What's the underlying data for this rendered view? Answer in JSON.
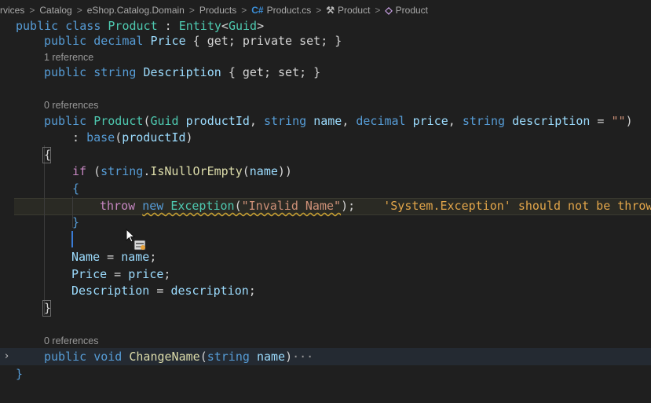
{
  "breadcrumb": {
    "items": [
      "rvices",
      "Catalog",
      "eShop.Catalog.Domain",
      "Products",
      "Product.cs",
      "Product",
      "Product"
    ],
    "separator": ">",
    "icons": {
      "file": "csharp-file-icon",
      "property": "wrench-property-icon",
      "class": "class-icon"
    },
    "file_icon_text": "C#",
    "property_icon_text": "⚒",
    "class_icon_text": "◇"
  },
  "code": {
    "line_class": {
      "kw1": "public",
      "kw2": "class",
      "name": "Product",
      "colon": " : ",
      "base": "Entity",
      "lt": "<",
      "generic": "Guid",
      "gt": ">"
    },
    "line_price": {
      "kw": "public",
      "type": "decimal",
      "name": "Price",
      "accessor": "{ get; private set; }"
    },
    "lens_1": "1 reference",
    "line_desc": {
      "kw": "public",
      "type": "string",
      "name": "Description",
      "accessor": "{ get; set; }"
    },
    "lens_2": "0 references",
    "line_ctor": {
      "kw": "public",
      "name": "Product",
      "open": "(",
      "t1": "Guid",
      "p1": "productId",
      "c1": ", ",
      "t2": "string",
      "p2": "name",
      "c2": ", ",
      "t3": "decimal",
      "p3": "price",
      "c3": ", ",
      "t4": "string",
      "p4": "description",
      "eq": " = ",
      "default": "\"\"",
      "close": ")"
    },
    "line_base": {
      "colon": ": ",
      "kw": "base",
      "open": "(",
      "arg": "productId",
      "close": ")"
    },
    "open_brace": "{",
    "line_if": {
      "kw": "if",
      "open": " (",
      "type": "string",
      "dot": ".",
      "fn": "IsNullOrEmpty",
      "paren": "(",
      "arg": "name",
      "close": "))"
    },
    "inner_open": "{",
    "line_throw": {
      "kw1": "throw",
      "kw2": "new",
      "type": "Exception",
      "open": "(",
      "msg": "\"Invalid Name\"",
      "close": ");",
      "warning": "'System.Exception' should not be throw"
    },
    "inner_close": "}",
    "line_name": {
      "lhs": "Name",
      "eq": " = ",
      "rhs": "name",
      "end": ";"
    },
    "line_price_assign": {
      "lhs": "Price",
      "eq": " = ",
      "rhs": "price",
      "end": ";"
    },
    "line_desc_assign": {
      "lhs": "Description",
      "eq": " = ",
      "rhs": "description",
      "end": ";"
    },
    "close_brace": "}",
    "lens_3": "0 references",
    "line_change": {
      "kw": "public",
      "type": "void",
      "name": "ChangeName",
      "open": "(",
      "ptype": "string",
      "pname": "name",
      "close": ")",
      "ellipsis": "···"
    },
    "class_close": "}"
  },
  "fold_icon": "›",
  "colors": {
    "background": "#1f1f1f",
    "keyword": "#569cd6",
    "type": "#4ec9b0",
    "function": "#dcdcaa",
    "parameter": "#9cdcfe",
    "string": "#ce9178",
    "control": "#c586c0",
    "warning": "#e2a54a"
  }
}
